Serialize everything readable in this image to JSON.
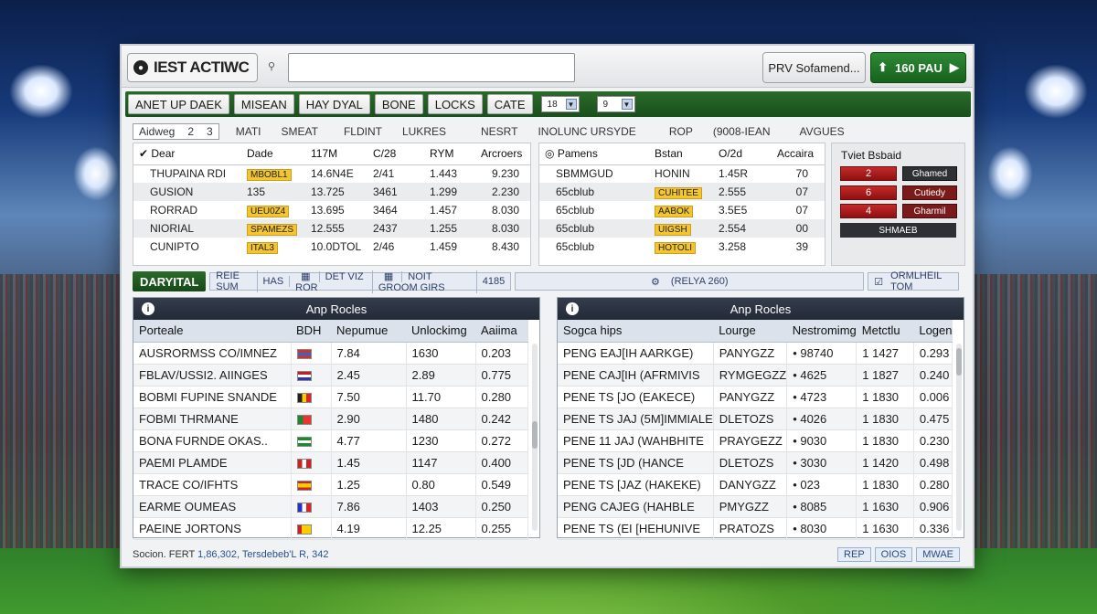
{
  "window": {
    "title": "IEST ACTIWC",
    "search_placeholder": "",
    "prv_button": "PRV Sofamend...",
    "green_button": "160 PAU"
  },
  "nav": {
    "tabs": [
      "ANET UP DAEK",
      "MISEAN",
      "HAY DYAL",
      "BONE",
      "LOCKS",
      "CATE"
    ],
    "select1": "18",
    "select2": "9"
  },
  "filters": {
    "tag_label": "Aidweg",
    "tag_v1": "2",
    "tag_v2": "3",
    "items": [
      "MATI",
      "SMEAT",
      "FLDINT",
      "LUKRES",
      "NESRT",
      "INOLUNC URSYDE",
      "ROP",
      "(9008-IEAN",
      "AVGUES"
    ]
  },
  "left_top": {
    "headers": [
      "Dear",
      "Dade",
      "117M",
      "C/28",
      "RYM",
      "Arcroers"
    ],
    "rows": [
      [
        "THUPAINA RDI",
        "MBOBL1",
        "14.6N4E",
        "2/41",
        "1.443",
        "9.230"
      ],
      [
        "GUSION",
        "135",
        "13.725",
        "3461",
        "1.299",
        "2.230"
      ],
      [
        "RORRAD",
        "UEU0Z4",
        "13.695",
        "3464",
        "1.457",
        "8.030"
      ],
      [
        "NIORIAL",
        "SPAMEZS",
        "12.555",
        "2437",
        "1.255",
        "8.030"
      ],
      [
        "CUNIPTO",
        "ITAL3",
        "10.0DTOL",
        "2/46",
        "1.459",
        "8.430"
      ]
    ]
  },
  "right_top": {
    "headers": [
      "Pamens",
      "Bstan",
      "O/2d",
      "Accaira"
    ],
    "rows": [
      [
        "SBMMGUD",
        "HONIN",
        "1.45R",
        "70"
      ],
      [
        "65cblub",
        "CUHITEE",
        "2.555",
        "07"
      ],
      [
        "65cblub",
        "AABOK",
        "3.5E5",
        "07"
      ],
      [
        "65cblub",
        "UIGSH",
        "2.554",
        "00"
      ],
      [
        "65cblub",
        "HOTOLI",
        "3.258",
        "39"
      ]
    ]
  },
  "side": {
    "header": "Tviet Bsbaid",
    "rows": [
      {
        "num": "2",
        "label": "Ghamed"
      },
      {
        "num": "6",
        "label": "Cutiedy"
      },
      {
        "num": "4",
        "label": "Gharmil"
      }
    ],
    "wide": "SHMAEB"
  },
  "section_bar": {
    "primary": "DARYITAL",
    "items": [
      "REIE SUM",
      "HAS",
      "DET VIZ ROR",
      "NOIT GROOM GIRS",
      "4185"
    ],
    "center": "(RELYA 260)",
    "right": "ORMLHEIL TOM"
  },
  "left_panel": {
    "title": "Anp Rocles",
    "headers": [
      "Porteale",
      "BDH",
      "Nepumue",
      "Unlockimg",
      "Aaiima"
    ],
    "rows": [
      [
        "AUSRORMSS CO/IMNEZ",
        "7.84",
        "1630",
        "0.203"
      ],
      [
        "FBLAV/USSI2. AIINGES",
        "2.45",
        "2.89",
        "0.775"
      ],
      [
        "BOBMI FUPINE SNANDE",
        "7.50",
        "11.70",
        "0.280"
      ],
      [
        "FOBMI THRMANE",
        "2.90",
        "1480",
        "0.242"
      ],
      [
        "BONA FURNDE OKAS..",
        "4.77",
        "1230",
        "0.272"
      ],
      [
        "PAEMI PLAMDE",
        "1.45",
        "1147",
        "0.400"
      ],
      [
        "TRACE CO/IFHTS",
        "1.25",
        "0.80",
        "0.549"
      ],
      [
        "EARME OUMEAS",
        "7.86",
        "1403",
        "0.250"
      ],
      [
        "PAEINE JORTONS",
        "4.19",
        "12.25",
        "0.255"
      ]
    ]
  },
  "right_panel": {
    "title": "Anp Rocles",
    "headers": [
      "Sogca hips",
      "Lourge",
      "Nestromimg",
      "Metctlu",
      "Logen"
    ],
    "rows": [
      [
        "PENG EAJ[IH AARKGE)",
        "PANYGZZ",
        "• 98740",
        "1 1427",
        "0.293"
      ],
      [
        "PENE CAJ[IH (AFRMIVIS",
        "RYMGEGZZ",
        "• 4625",
        "1 1827",
        "0.240"
      ],
      [
        "PENE TS [JO (EAKECE)",
        "PANYGZZ",
        "• 4723",
        "1 1830",
        "0.006"
      ],
      [
        "PENE TS JAJ (5M]IMMIALE",
        "DLETOZS",
        "• 4026",
        "1 1830",
        "0.475"
      ],
      [
        "PENE 11 JAJ (WAHBHITE",
        "PRAYGEZZ",
        "• 9030",
        "1 1830",
        "0.230"
      ],
      [
        "PENE TS [JD (HANCE",
        "DLETOZS",
        "• 3030",
        "1 1420",
        "0.498"
      ],
      [
        "PENE TS [JAZ (HAKEKE)",
        "DANYGZZ",
        "• 023",
        "1 1830",
        "0.280"
      ],
      [
        "PENG CAJEG (HAHBLE",
        "PMYGZZ",
        "• 8085",
        "1 1630",
        "0.906"
      ],
      [
        "PENE TS (EI [HEHUNIVE",
        "PRATOZS",
        "• 8030",
        "1 1630",
        "0.336"
      ]
    ]
  },
  "status": {
    "prefix": "Socion. FERT",
    "text": "1,86,302, Tersdebeb'L R, 342",
    "buttons": [
      "REP",
      "OIOS",
      "MWAE"
    ]
  },
  "colors": {
    "green": "#1e5a20",
    "accent_yellow": "#f3c531",
    "red": "#b31b1b",
    "dark": "#2b2f35"
  }
}
